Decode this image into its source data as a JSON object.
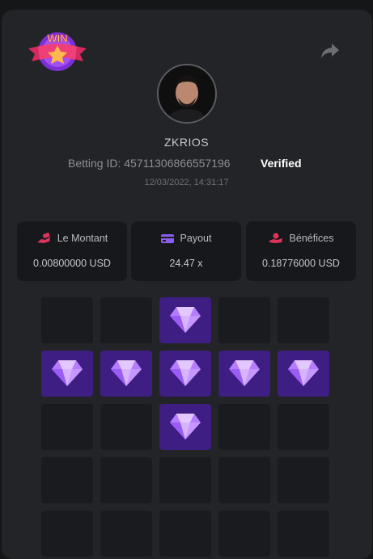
{
  "player": {
    "name": "ZKRIOS",
    "betting_id": "Betting ID: 4571130686655719​6",
    "verified": "Verified",
    "timestamp": "12/03/2022, 14:31:17"
  },
  "stats": [
    {
      "icon": "hand-money-icon",
      "label": "Le Montant",
      "value": "0.00800000 USD",
      "color": "#e0335a"
    },
    {
      "icon": "wallet-icon",
      "label": "Payout",
      "value": "24.47 x",
      "color": "#8a5cf0"
    },
    {
      "icon": "hand-coin-icon",
      "label": "Bénéfices",
      "value": "0.18776000 USD",
      "color": "#e0335a"
    }
  ],
  "badge": {
    "text": "WIN"
  },
  "grid": {
    "cols": 5,
    "rows": [
      [
        0,
        0,
        1,
        0,
        0
      ],
      [
        1,
        1,
        1,
        1,
        1
      ],
      [
        0,
        0,
        1,
        0,
        0
      ],
      [
        0,
        0,
        0,
        0,
        0
      ],
      [
        0,
        0,
        0,
        0,
        0
      ]
    ]
  }
}
